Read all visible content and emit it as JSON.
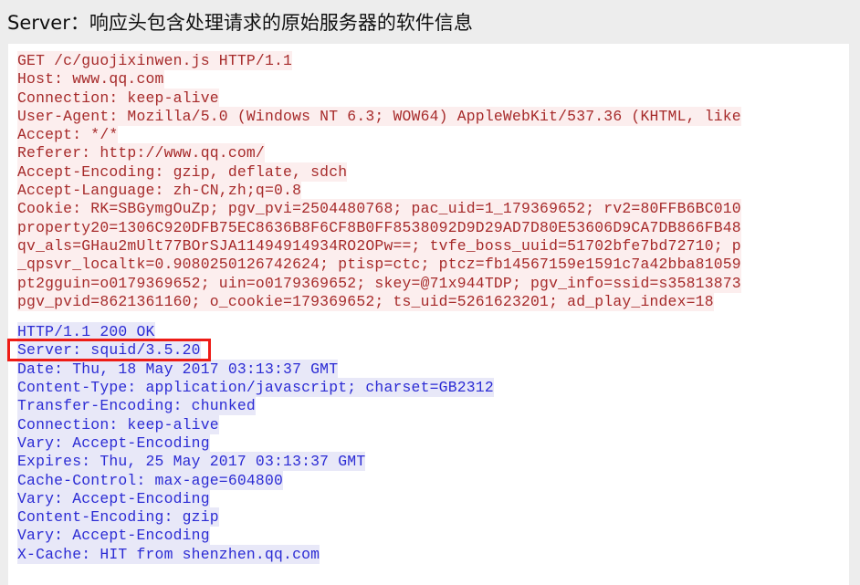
{
  "title": "Server：响应头包含处理请求的原始服务器的软件信息",
  "colors": {
    "request_text": "#a62a2a",
    "request_highlight": "#fceeee",
    "response_text": "#2b2bd4",
    "response_highlight": "#e8e8f8",
    "annotation_box": "#ee1c16",
    "page_background": "#ededed",
    "panel_background": "#ffffff"
  },
  "request": {
    "lines": [
      "GET /c/guojixinwen.js HTTP/1.1",
      "Host: www.qq.com",
      "Connection: keep-alive",
      "User-Agent: Mozilla/5.0 (Windows NT 6.3; WOW64) AppleWebKit/537.36 (KHTML, like",
      "Accept: */*",
      "Referer: http://www.qq.com/",
      "Accept-Encoding: gzip, deflate, sdch",
      "Accept-Language: zh-CN,zh;q=0.8",
      "Cookie: RK=SBGymgOuZp; pgv_pvi=2504480768; pac_uid=1_179369652; rv2=80FFB6BC010",
      "property20=1306C920DFB75EC8636B8F6CF8B0FF8538092D9D29AD7D80E53606D9CA7DB866FB48",
      "qv_als=GHau2mUlt77BOrSJA11494914934RO2OPw==; tvfe_boss_uuid=51702bfe7bd72710; p",
      "_qpsvr_localtk=0.9080250126742624; ptisp=ctc; ptcz=fb14567159e1591c7a42bba81059",
      "pt2gguin=o0179369652; uin=o0179369652; skey=@71x944TDP; pgv_info=ssid=s35813873",
      "pgv_pvid=8621361160; o_cookie=179369652; ts_uid=5261623201; ad_play_index=18"
    ]
  },
  "response": {
    "lines": [
      "HTTP/1.1 200 OK",
      "Server: squid/3.5.20",
      "Date: Thu, 18 May 2017 03:13:37 GMT",
      "Content-Type: application/javascript; charset=GB2312",
      "Transfer-Encoding: chunked",
      "Connection: keep-alive",
      "Vary: Accept-Encoding",
      "Expires: Thu, 25 May 2017 03:13:37 GMT",
      "Cache-Control: max-age=604800",
      "Vary: Accept-Encoding",
      "Content-Encoding: gzip",
      "Vary: Accept-Encoding",
      "X-Cache: HIT from shenzhen.qq.com"
    ],
    "highlighted_line_index": 1
  }
}
